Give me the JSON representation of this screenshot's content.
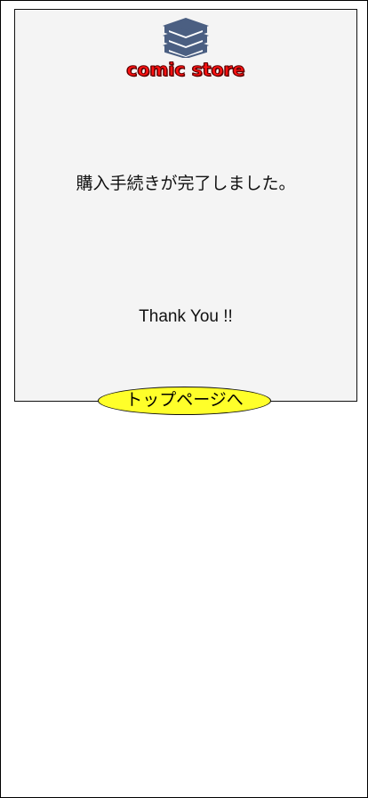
{
  "brand": {
    "name": "comic store",
    "icon": "books-icon",
    "primary_color": "#ff1111",
    "icon_color": "#4b5f82"
  },
  "confirmation": {
    "message_ja": "購入手続きが完了しました。",
    "thank_you": "Thank You !!"
  },
  "actions": {
    "top_page_label": "トップページへ",
    "button_color": "#ffff2a"
  }
}
